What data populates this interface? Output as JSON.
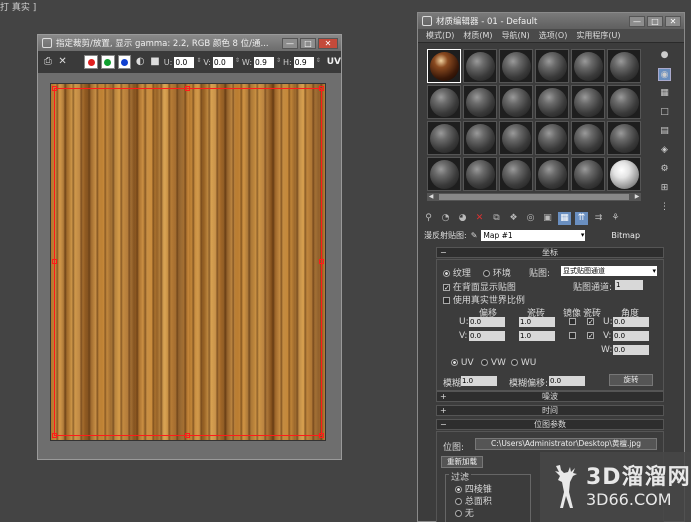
{
  "top_fragment": "打 真实 ]",
  "crop_window": {
    "title": "指定裁剪/放置, 显示 gamma: 2.2, RGB 颜色 8 位/通...",
    "win_buttons": [
      "—",
      "□",
      "✕"
    ],
    "coords": [
      {
        "label": "U:",
        "value": "0.0"
      },
      {
        "label": "V:",
        "value": "0.0"
      },
      {
        "label": "W:",
        "value": "0.9"
      },
      {
        "label": "H:",
        "value": "0.9"
      }
    ],
    "uv_label": "UV"
  },
  "material_editor": {
    "title": "材质编辑器 - 01 - Default",
    "menu": [
      "模式(D)",
      "材质(M)",
      "导航(N)",
      "选项(O)",
      "实用程序(U)"
    ],
    "map_label": "漫反射贴图:",
    "map_name": "Map #1",
    "map_type": "Bitmap",
    "coords_rollout": {
      "title": "坐标",
      "texture": "纹理",
      "environ": "环境",
      "mapping_label": "贴图:",
      "mapping_value": "显式贴图通道",
      "show_on_back": "在背面显示贴图",
      "map_channel_label": "贴图通道:",
      "map_channel_value": "1",
      "real_world": "使用真实世界比例",
      "col_offset": "偏移",
      "col_tiling": "瓷砖",
      "col_mirror": "镜像",
      "col_tile": "瓷砖",
      "col_angle": "角度",
      "u_label": "U:",
      "v_label": "V:",
      "w_label": "W:",
      "u_offset": "0.0",
      "v_offset": "0.0",
      "u_tiling": "1.0",
      "v_tiling": "1.0",
      "u_angle": "0.0",
      "v_angle": "0.0",
      "w_angle": "0.0",
      "uv": "UV",
      "vw": "VW",
      "wu": "WU",
      "blur_label": "模糊:",
      "blur_value": "1.0",
      "blur_offset_label": "模糊偏移:",
      "blur_offset_value": "0.0",
      "rotate": "旋转"
    },
    "rollouts": [
      "噪波",
      "时间",
      "位图参数"
    ],
    "bitmap_params": {
      "bitmap_label": "位图:",
      "bitmap_path": "C:\\Users\\Administrator\\Desktop\\黄檀.jpg",
      "reload": "重新加载",
      "filter_label": "过滤",
      "filter_options": [
        "四棱锥",
        "总面积",
        "无"
      ]
    }
  },
  "watermark": {
    "cn": "3D溜溜网",
    "url": "3D66.COM"
  }
}
